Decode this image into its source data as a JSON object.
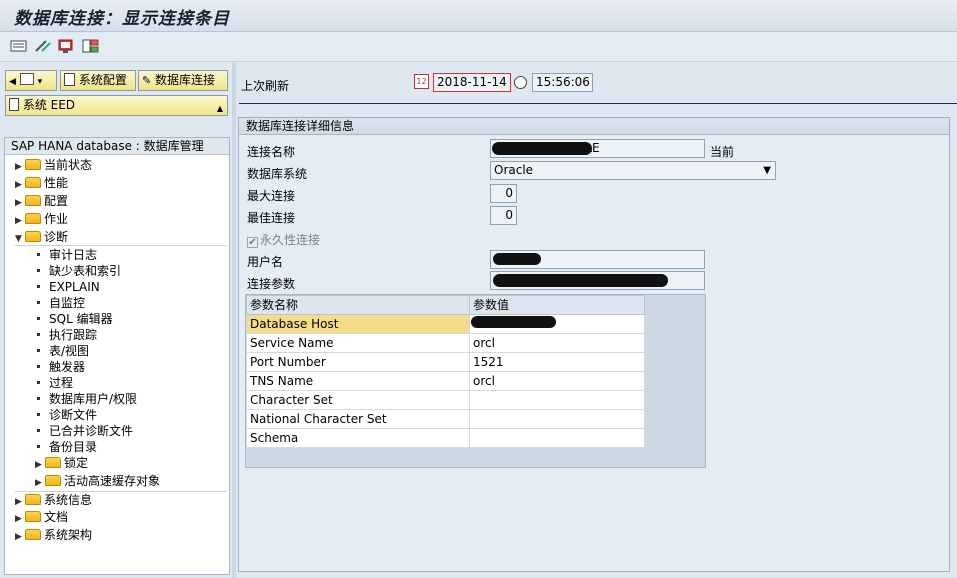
{
  "title": "数据库连接：显示连接条目",
  "toolbar": {
    "icons": [
      "list-icon",
      "edit-pencil-icon",
      "display-icon",
      "layout-icon"
    ]
  },
  "left": {
    "nav_button_1": "系统配置",
    "nav_button_2": "数据库连接",
    "system_selector": "系统 EED",
    "tree_header": "SAP HANA database : 数据库管理",
    "tree": {
      "current_status": "当前状态",
      "performance": "性能",
      "config": "配置",
      "jobs": "作业",
      "diagnosis": "诊断",
      "diag_items": [
        "审计日志",
        "缺少表和索引",
        "EXPLAIN",
        "自监控",
        "SQL 编辑器",
        "执行跟踪",
        "表/视图",
        "触发器",
        "过程",
        "数据库用户/权限",
        "诊断文件",
        "已合并诊断文件",
        "备份目录"
      ],
      "locks": "锁定",
      "active_cache": "活动高速缓存对象",
      "system_info": "系统信息",
      "documents": "文档",
      "system_arch": "系统架构"
    }
  },
  "refresh": {
    "label": "上次刷新",
    "date": "2018-11-14",
    "time": "15:56:06"
  },
  "details": {
    "group_title": "数据库连接详细信息",
    "conn_name_label": "连接名称",
    "conn_name_value": "EDBCON_ORACLE",
    "current_label": "当前",
    "db_system_label": "数据库系统",
    "db_system_value": "Oracle",
    "max_conn_label": "最大连接",
    "max_conn_value": "0",
    "opt_conn_label": "最佳连接",
    "opt_conn_value": "0",
    "persistent_label": "永久性连接",
    "user_label": "用户名",
    "conn_params_label": "连接参数",
    "param_table": {
      "headers": [
        "参数名称",
        "参数值"
      ],
      "rows": [
        {
          "name": "Database Host",
          "value": ""
        },
        {
          "name": "Service Name",
          "value": "orcl"
        },
        {
          "name": "Port Number",
          "value": "1521"
        },
        {
          "name": "TNS Name",
          "value": "orcl"
        },
        {
          "name": "Character Set",
          "value": ""
        },
        {
          "name": "National Character Set",
          "value": ""
        },
        {
          "name": "Schema",
          "value": ""
        }
      ]
    }
  }
}
